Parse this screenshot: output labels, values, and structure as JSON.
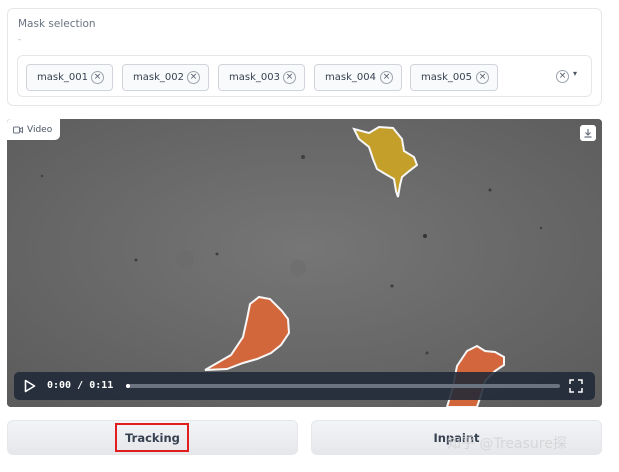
{
  "mask_selection": {
    "label": "Mask selection",
    "sub": "-",
    "chips": [
      "mask_001",
      "mask_002",
      "mask_003",
      "mask_004",
      "mask_005"
    ],
    "remove_glyph": "×",
    "clear_glyph": "×",
    "caret_glyph": "▾"
  },
  "video": {
    "badge_label": "Video",
    "time_current": "0:00",
    "time_separator": "/",
    "time_total": "0:11",
    "progress": 0.01,
    "icons": [
      "video-camera-icon",
      "download-icon",
      "play-icon",
      "fullscreen-icon"
    ]
  },
  "buttons": {
    "tracking": "Tracking",
    "inpaint": "Inpaint"
  },
  "watermark": "知乎 @Treasure探",
  "colors": {
    "mask_yellow": "#c9a227",
    "mask_orange": "#d9673a",
    "highlight_red": "#e11d1d",
    "control_bar": "#1f2937"
  }
}
